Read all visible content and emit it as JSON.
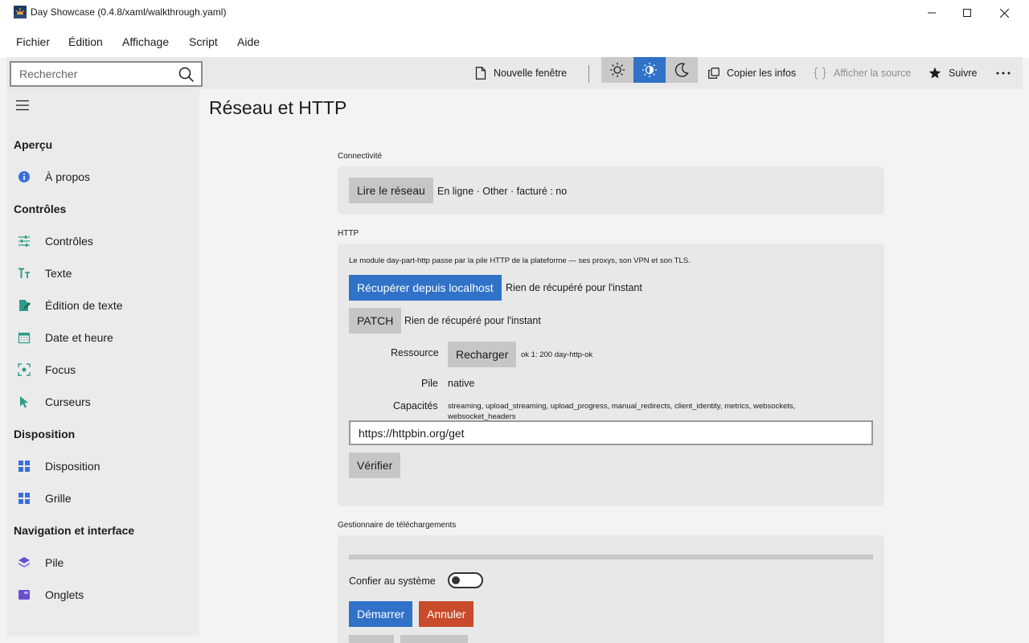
{
  "window": {
    "title": "Day Showcase (0.4.8/xaml/walkthrough.yaml)"
  },
  "menu": {
    "items": [
      "Fichier",
      "Édition",
      "Affichage",
      "Script",
      "Aide"
    ]
  },
  "toolbar": {
    "search_placeholder": "Rechercher",
    "new_window": "Nouvelle fenêtre",
    "copy_info": "Copier les infos",
    "view_source": "Afficher la source",
    "follow": "Suivre",
    "active_theme": "system",
    "accent_color": "#3072c8"
  },
  "sidebar": {
    "sections": [
      {
        "heading": "Aperçu",
        "items": [
          {
            "label": "À propos",
            "icon": "info-icon"
          }
        ]
      },
      {
        "heading": "Contrôles",
        "items": [
          {
            "label": "Contrôles",
            "icon": "sliders-icon"
          },
          {
            "label": "Texte",
            "icon": "text-size-icon"
          },
          {
            "label": "Édition de texte",
            "icon": "edit-document-icon"
          },
          {
            "label": "Date et heure",
            "icon": "calendar-icon"
          },
          {
            "label": "Focus",
            "icon": "focus-icon"
          },
          {
            "label": "Curseurs",
            "icon": "cursor-icon"
          }
        ]
      },
      {
        "heading": "Disposition",
        "items": [
          {
            "label": "Disposition",
            "icon": "layout-icon"
          },
          {
            "label": "Grille",
            "icon": "grid-icon"
          }
        ]
      },
      {
        "heading": "Navigation et interface",
        "items": [
          {
            "label": "Pile",
            "icon": "stack-icon"
          },
          {
            "label": "Onglets",
            "icon": "tabs-icon"
          }
        ]
      }
    ]
  },
  "main": {
    "title": "Réseau et HTTP",
    "connectivity": {
      "label": "Connectivité",
      "button": "Lire le réseau",
      "status": "En ligne · Other · facturé : no"
    },
    "http": {
      "label": "HTTP",
      "description": "Le module day-part-http passe par la pile HTTP de la plateforme — ses proxys, son VPN et son TLS.",
      "fetch_button": "Récupérer depuis localhost",
      "fetch_result": "Rien de récupéré pour l'instant",
      "patch_button": "PATCH",
      "patch_result": "Rien de récupéré pour l'instant",
      "resource_label": "Ressource",
      "reload_button": "Recharger",
      "resource_result": "ok 1: 200 day-http-ok",
      "stack_label": "Pile",
      "stack_value": "native",
      "capabilities_label": "Capacités",
      "capabilities_value": "streaming, upload_streaming, upload_progress, manual_redirects, client_identity, metrics, websockets, websocket_headers",
      "url_value": "https://httpbin.org/get",
      "verify_button": "Vérifier"
    },
    "downloads": {
      "label": "Gestionnaire de téléchargements",
      "progress": 0,
      "system_label": "Confier au système",
      "system_enabled": false,
      "start_button": "Démarrer",
      "cancel_button": "Annuler"
    }
  }
}
